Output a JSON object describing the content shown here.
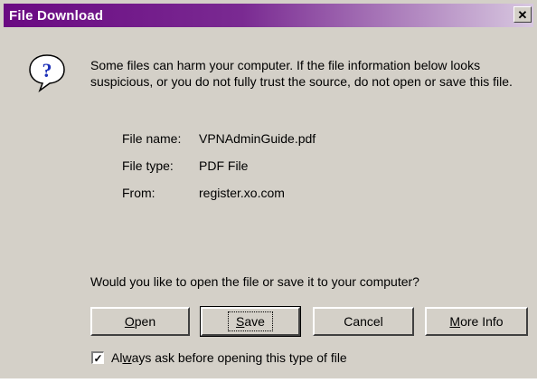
{
  "window": {
    "title": "File Download",
    "close_glyph": "✕"
  },
  "message": {
    "icon": "question-icon",
    "text": "Some files can harm your computer. If the file information below looks suspicious, or you do not fully trust the source, do not open or save this file."
  },
  "file_info": {
    "name_label": "File name:",
    "name_value": "VPNAdminGuide.pdf",
    "type_label": "File type:",
    "type_value": "PDF File",
    "from_label": "From:",
    "from_value": "register.xo.com"
  },
  "question": "Would you like to open the file or save it to your computer?",
  "buttons": {
    "open_pre": "",
    "open_ul": "O",
    "open_post": "pen",
    "save_pre": "",
    "save_ul": "S",
    "save_post": "ave",
    "cancel": "Cancel",
    "more_pre": "",
    "more_ul": "M",
    "more_post": "ore Info"
  },
  "always_ask": {
    "checked": true,
    "check_glyph": "✓",
    "pre": "Al",
    "ul": "w",
    "post": "ays ask before opening this type of file"
  },
  "colors": {
    "title_bar_start": "#6a0a82",
    "dialog_face": "#d4d0c8",
    "icon_blue": "#1c2fb8"
  }
}
